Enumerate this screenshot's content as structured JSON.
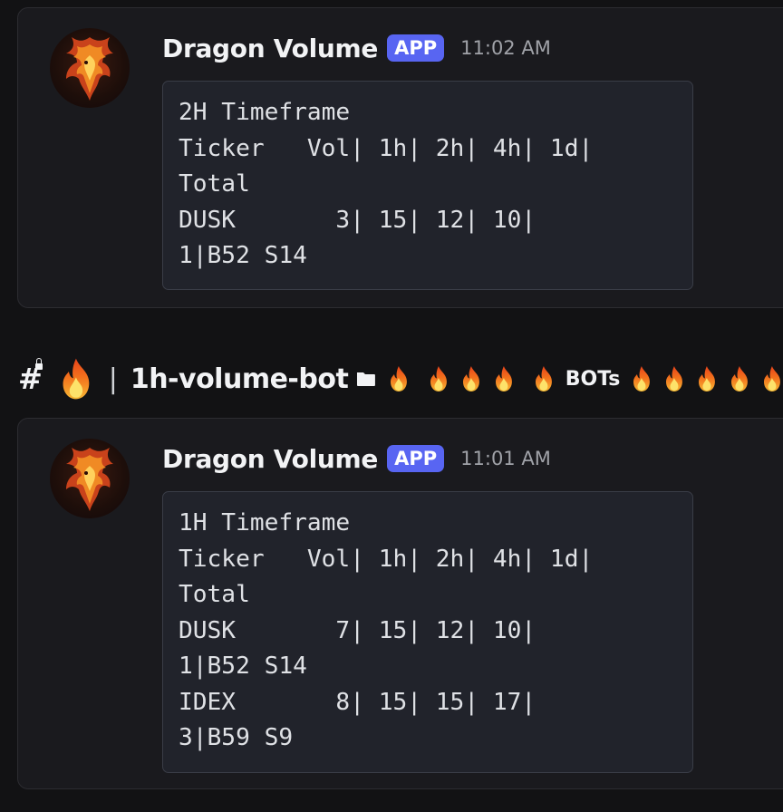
{
  "messages": [
    {
      "username": "Dragon Volume",
      "badge": "APP",
      "timestamp": "11:02 AM",
      "code": "2H Timeframe\nTicker   Vol| 1h| 2h| 4h| 1d|\nTotal\nDUSK       3| 15| 12| 10|\n1|B52 S14"
    },
    {
      "username": "Dragon Volume",
      "badge": "APP",
      "timestamp": "11:01 AM",
      "code": "1H Timeframe\nTicker   Vol| 1h| 2h| 4h| 1d|\nTotal\nDUSK       7| 15| 12| 10|\n1|B52 S14\nIDEX       8| 15| 15| 17|\n3|B59 S9"
    }
  ],
  "channel": {
    "hash": "#",
    "separator": "|",
    "name": "1h-volume-bot",
    "bots_label": "BOTs"
  },
  "colors": {
    "background": "#121214",
    "card": "#1a1a1e",
    "code_block": "#21232b",
    "badge": "#5865f2",
    "text": "#f2f3f5",
    "muted": "#a0a2a8"
  }
}
